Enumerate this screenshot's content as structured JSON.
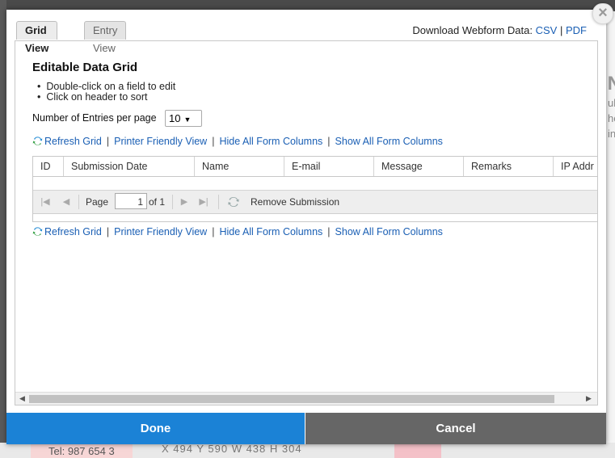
{
  "background": {
    "right_letters": [
      "lN",
      "ub",
      "he",
      "in"
    ],
    "bottom_tel": "Tel: 987 654 3",
    "bottom_coords": "X  494   Y  590   W  438   H  304"
  },
  "modal": {
    "close_icon": "close-icon",
    "tabs": [
      {
        "label": "Grid View",
        "active": true
      },
      {
        "label": "Entry View",
        "active": false
      }
    ],
    "download": {
      "label": "Download Webform Data:",
      "csv": "CSV",
      "separator": "|",
      "pdf": "PDF"
    },
    "heading": "Editable Data Grid",
    "instructions": [
      "Double-click on a field to edit",
      "Click on header to sort"
    ],
    "entries_label": "Number of Entries per page",
    "entries_value": "10",
    "linkbar": {
      "refresh": "Refresh Grid",
      "printer": "Printer Friendly View",
      "hide": "Hide All Form Columns",
      "show": "Show All Form Columns",
      "separator": "|"
    },
    "grid": {
      "columns": [
        "ID",
        "Submission Date",
        "Name",
        "E-mail",
        "Message",
        "Remarks",
        "IP Addr"
      ],
      "pager": {
        "page_label": "Page",
        "page_value": "1",
        "of_label": "of 1",
        "remove_label": "Remove Submission"
      }
    },
    "footer": {
      "done": "Done",
      "cancel": "Cancel"
    }
  },
  "colors": {
    "done": "#1b82d6",
    "cancel": "#666666",
    "link": "#1a5fb4"
  }
}
